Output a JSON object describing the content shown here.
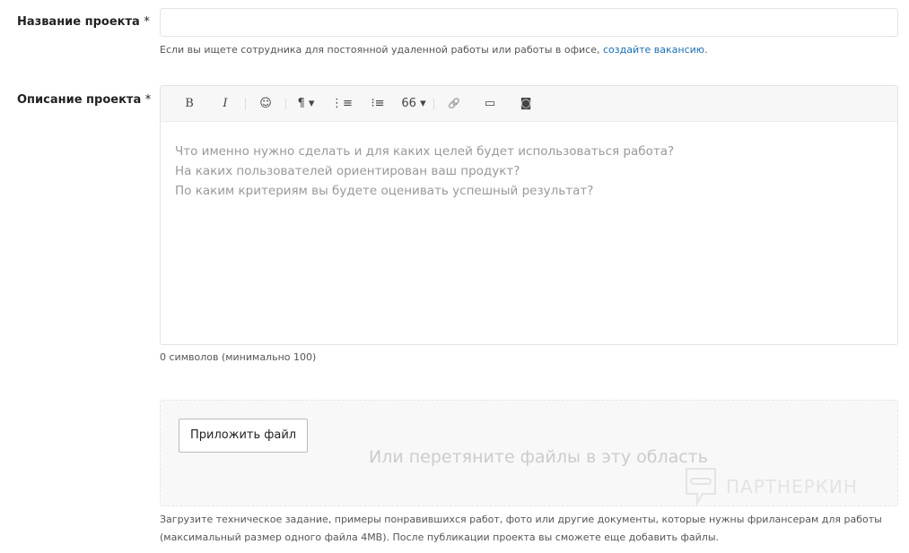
{
  "name_field": {
    "label": "Название проекта",
    "required": "*",
    "value": ""
  },
  "name_hint": {
    "text": "Если вы ищете сотрудника для постоянной удаленной работы или работы в офисе,",
    "link": "создайте вакансию",
    "end": "."
  },
  "description": {
    "label": "Описание проекта",
    "required": "*",
    "toolbar": [
      {
        "icon": "bold-icon",
        "glyph": "B"
      },
      {
        "icon": "italic-icon",
        "glyph": "I"
      },
      {
        "icon": "emoji-icon",
        "glyph": "☺"
      },
      {
        "icon": "paragraph-icon",
        "glyph": "¶ ▾"
      },
      {
        "icon": "ordered-list-icon",
        "glyph": "⋮≡"
      },
      {
        "icon": "bullet-list-icon",
        "glyph": "⁝≡"
      },
      {
        "icon": "quote-icon",
        "glyph": "66 ▾"
      },
      {
        "icon": "link-icon",
        "glyph": "🔗"
      },
      {
        "icon": "image-icon",
        "glyph": "▭"
      },
      {
        "icon": "camera-icon",
        "glyph": "◙"
      }
    ],
    "placeholder": [
      "Что именно нужно сделать и для каких целей будет использоваться работа?",
      "На каких пользователей ориентирован ваш продукт?",
      "По каким критериям вы будете оценивать успешный результат?"
    ],
    "counter": "0 символов (минимально 100)"
  },
  "upload": {
    "button": "Приложить файл",
    "drop_text": "Или перетяните файлы в эту область",
    "watermark": "ПАРТНЕРКИН",
    "hint1": "Загрузите техническое задание, примеры понравившихся работ, фото или другие документы, которые нужны фрилансерам для работы",
    "hint2": "(максимальный размер одного файла 4MB). После публикации проекта вы сможете еще добавить файлы."
  }
}
